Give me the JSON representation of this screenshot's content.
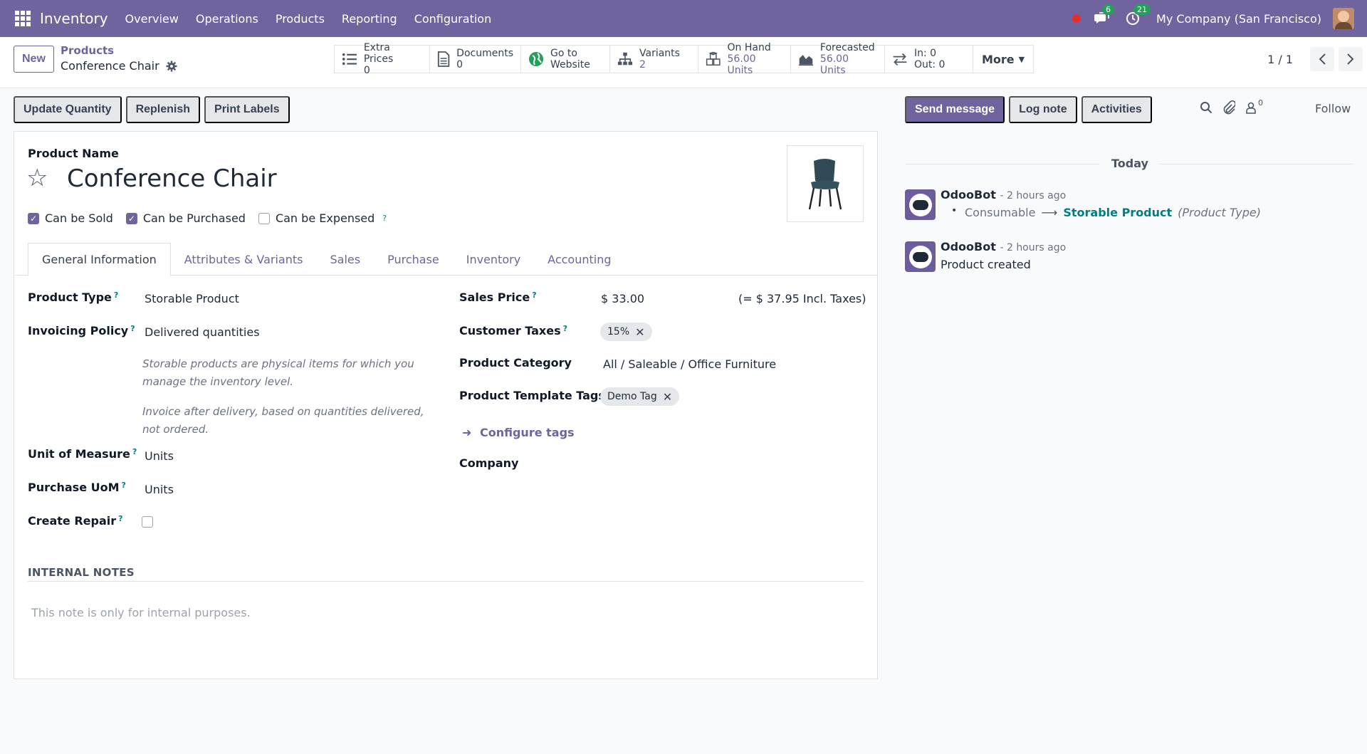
{
  "navbar": {
    "app_name": "Inventory",
    "menu": [
      "Overview",
      "Operations",
      "Products",
      "Reporting",
      "Configuration"
    ],
    "messages_badge": "6",
    "activities_badge": "21",
    "company": "My Company (San Francisco)"
  },
  "control": {
    "new_label": "New",
    "breadcrumb_parent": "Products",
    "breadcrumb_current": "Conference Chair",
    "smart_buttons": [
      {
        "icon": "list-icon",
        "glyph": "☰",
        "label": "Extra Prices",
        "value": "0"
      },
      {
        "icon": "document-icon",
        "glyph": "🗎",
        "label": "Documents",
        "value": "0"
      },
      {
        "icon": "globe-icon",
        "glyph": "●",
        "label": "Go to",
        "value": "Website"
      },
      {
        "icon": "sitemap-icon",
        "glyph": "⧉",
        "label": "Variants",
        "value": "2"
      },
      {
        "icon": "cubes-icon",
        "glyph": "❒",
        "label": "On Hand",
        "value": "56.00 Units"
      },
      {
        "icon": "area-chart-icon",
        "glyph": "◭",
        "label": "Forecasted",
        "value": "56.00 Units"
      },
      {
        "icon": "exchange-icon",
        "glyph": "⇄",
        "label": "In: 0",
        "value": "Out: 0"
      }
    ],
    "more_label": "More",
    "pager_value": "1 / 1"
  },
  "actions": [
    "Update Quantity",
    "Replenish",
    "Print Labels"
  ],
  "form": {
    "product_name_label": "Product Name",
    "product_name": "Conference Chair",
    "checks": [
      {
        "label": "Can be Sold",
        "checked": true,
        "help": false
      },
      {
        "label": "Can be Purchased",
        "checked": true,
        "help": false
      },
      {
        "label": "Can be Expensed",
        "checked": false,
        "help": true
      }
    ],
    "tabs": [
      "General Information",
      "Attributes & Variants",
      "Sales",
      "Purchase",
      "Inventory",
      "Accounting"
    ],
    "active_tab": "General Information",
    "product_type_label": "Product Type",
    "product_type": "Storable Product",
    "invoicing_policy_label": "Invoicing Policy",
    "invoicing_policy": "Delivered quantities",
    "hint_storable": "Storable products are physical items for which you manage the inventory level.",
    "hint_invoice": "Invoice after delivery, based on quantities delivered, not ordered.",
    "uom_label": "Unit of Measure",
    "uom": "Units",
    "purchase_uom_label": "Purchase UoM",
    "purchase_uom": "Units",
    "create_repair_label": "Create Repair",
    "create_repair_checked": false,
    "sales_price_label": "Sales Price",
    "sales_price": "$ 33.00",
    "sales_price_incl": "(= $ 37.95 Incl. Taxes)",
    "customer_taxes_label": "Customer Taxes",
    "customer_taxes_tag": "15%",
    "product_category_label": "Product Category",
    "product_category": "All / Saleable / Office Furniture",
    "template_tags_label": "Product Template Tags",
    "template_tag": "Demo Tag",
    "configure_tags": "Configure tags",
    "company_label": "Company",
    "internal_notes_title": "INTERNAL NOTES",
    "internal_notes_placeholder": "This note is only for internal purposes."
  },
  "chatter": {
    "send_message": "Send message",
    "log_note": "Log note",
    "activities": "Activities",
    "followers_count": "0",
    "follow": "Follow",
    "today": "Today",
    "messages": [
      {
        "author": "OdooBot",
        "time": "- 2 hours ago",
        "old_value": "Consumable",
        "new_value": "Storable Product",
        "field": "(Product Type)"
      },
      {
        "author": "OdooBot",
        "time": "- 2 hours ago",
        "body": "Product created"
      }
    ]
  },
  "colors": {
    "brand": "#71639e",
    "link_teal": "#017e84",
    "badge_green": "#25a05a",
    "record_red": "#e0312f"
  }
}
